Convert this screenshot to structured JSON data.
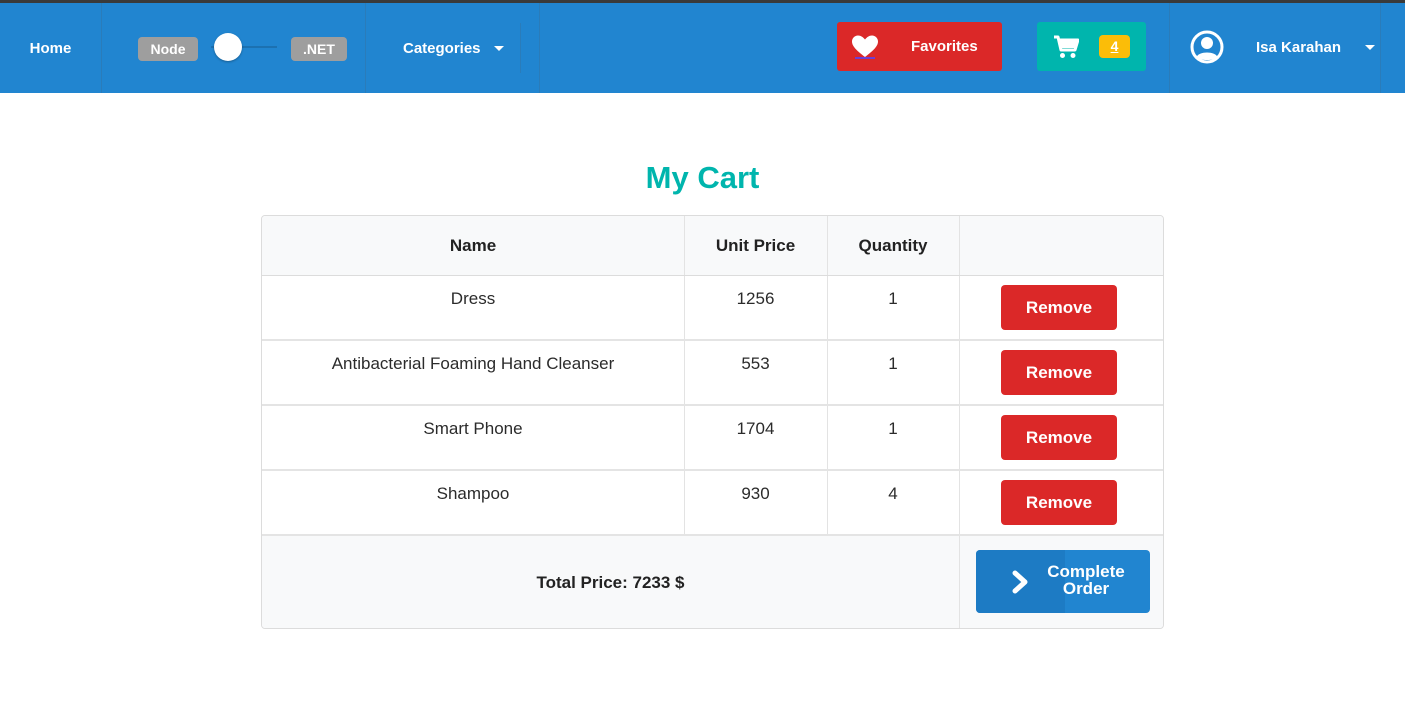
{
  "nav": {
    "home": "Home",
    "toggle": {
      "left": "Node",
      "right": ".NET",
      "selected": "Node"
    },
    "categories": "Categories",
    "favorites": "Favorites",
    "cart_count": "4",
    "user_name": "Isa Karahan"
  },
  "colors": {
    "navbar": "#2185d0",
    "favorites": "#db2828",
    "cart": "#00b5ad",
    "cart_badge": "#fbbd08",
    "title": "#00b5ad",
    "remove": "#db2828",
    "complete": "#2185d0"
  },
  "icons": {
    "favorites": "heart-icon",
    "cart": "shopping-cart-icon",
    "user": "user-circle-icon",
    "dropdown": "caret-down-icon",
    "complete": "chevron-right-icon"
  },
  "page": {
    "title": "My Cart"
  },
  "table": {
    "headers": [
      "Name",
      "Unit Price",
      "Quantity",
      ""
    ],
    "rows": [
      {
        "name": "Dress",
        "unit_price": "1256",
        "quantity": "1",
        "action": "Remove"
      },
      {
        "name": "Antibacterial Foaming Hand Cleanser",
        "unit_price": "553",
        "quantity": "1",
        "action": "Remove"
      },
      {
        "name": "Smart Phone",
        "unit_price": "1704",
        "quantity": "1",
        "action": "Remove"
      },
      {
        "name": "Shampoo",
        "unit_price": "930",
        "quantity": "4",
        "action": "Remove"
      }
    ],
    "total_label": "Total Price: 7233 $",
    "complete_line1": "Complete",
    "complete_line2": "Order"
  }
}
